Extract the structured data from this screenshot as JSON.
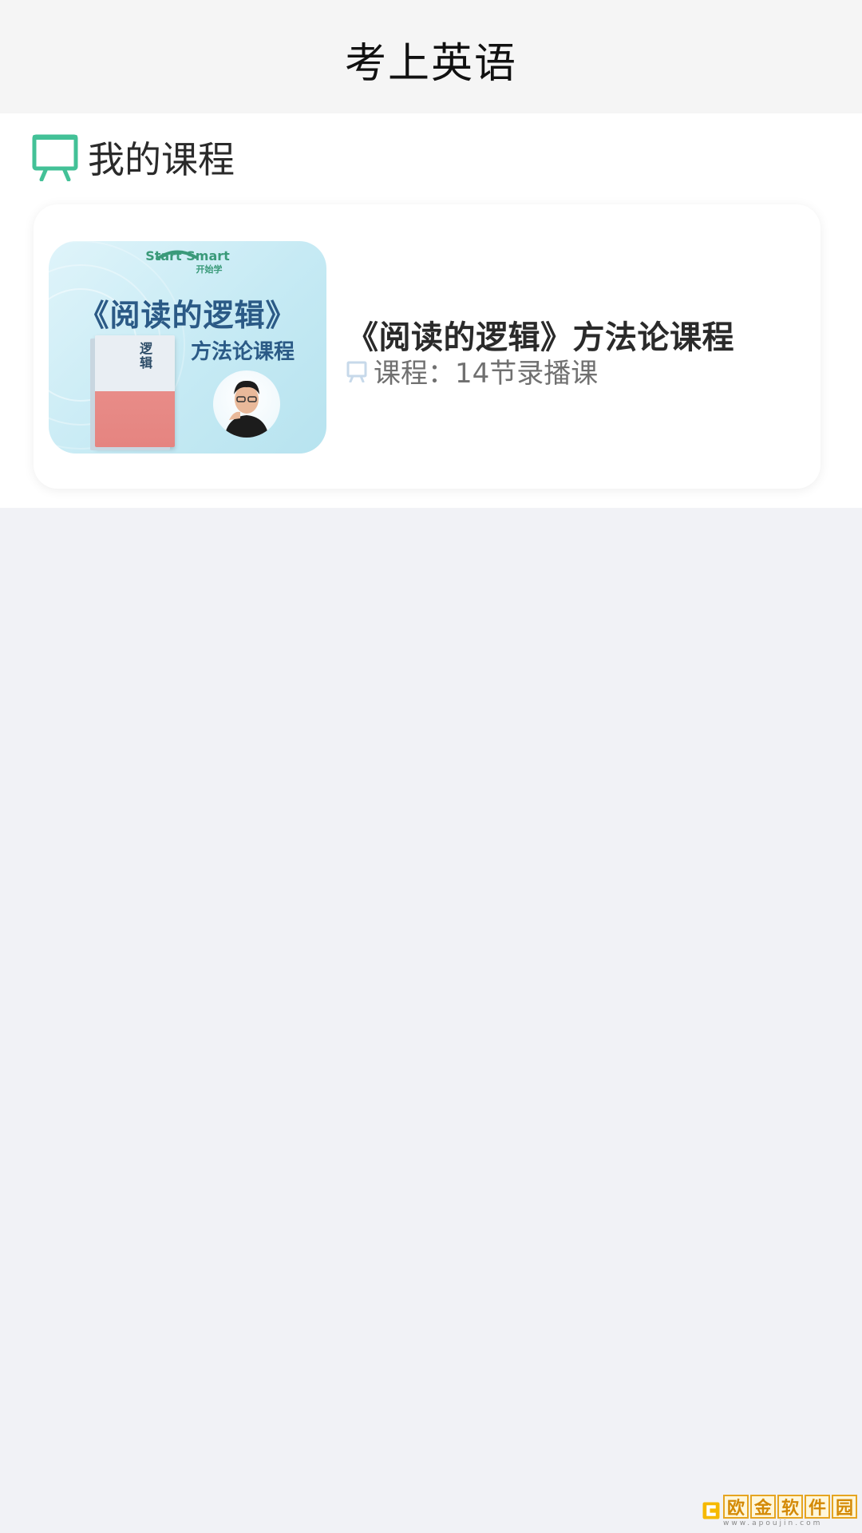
{
  "header": {
    "title": "考上英语"
  },
  "section": {
    "title": "我的课程",
    "icon": "presentation-board-icon",
    "accent_color": "#43c197"
  },
  "courses": [
    {
      "title": "《阅读的逻辑》方法论课程",
      "meta": "课程：14节录播课",
      "meta_icon": "presentation-board-icon",
      "thumbnail": {
        "brand": "Start Smart",
        "brand_sub": "开始学",
        "title": "《阅读的逻辑》",
        "subtitle": "方法论课程",
        "book_title": "逻辑"
      }
    }
  ],
  "watermark": {
    "chars": [
      "欧",
      "金",
      "软",
      "件",
      "园"
    ],
    "url": "www.apoujin.com"
  }
}
